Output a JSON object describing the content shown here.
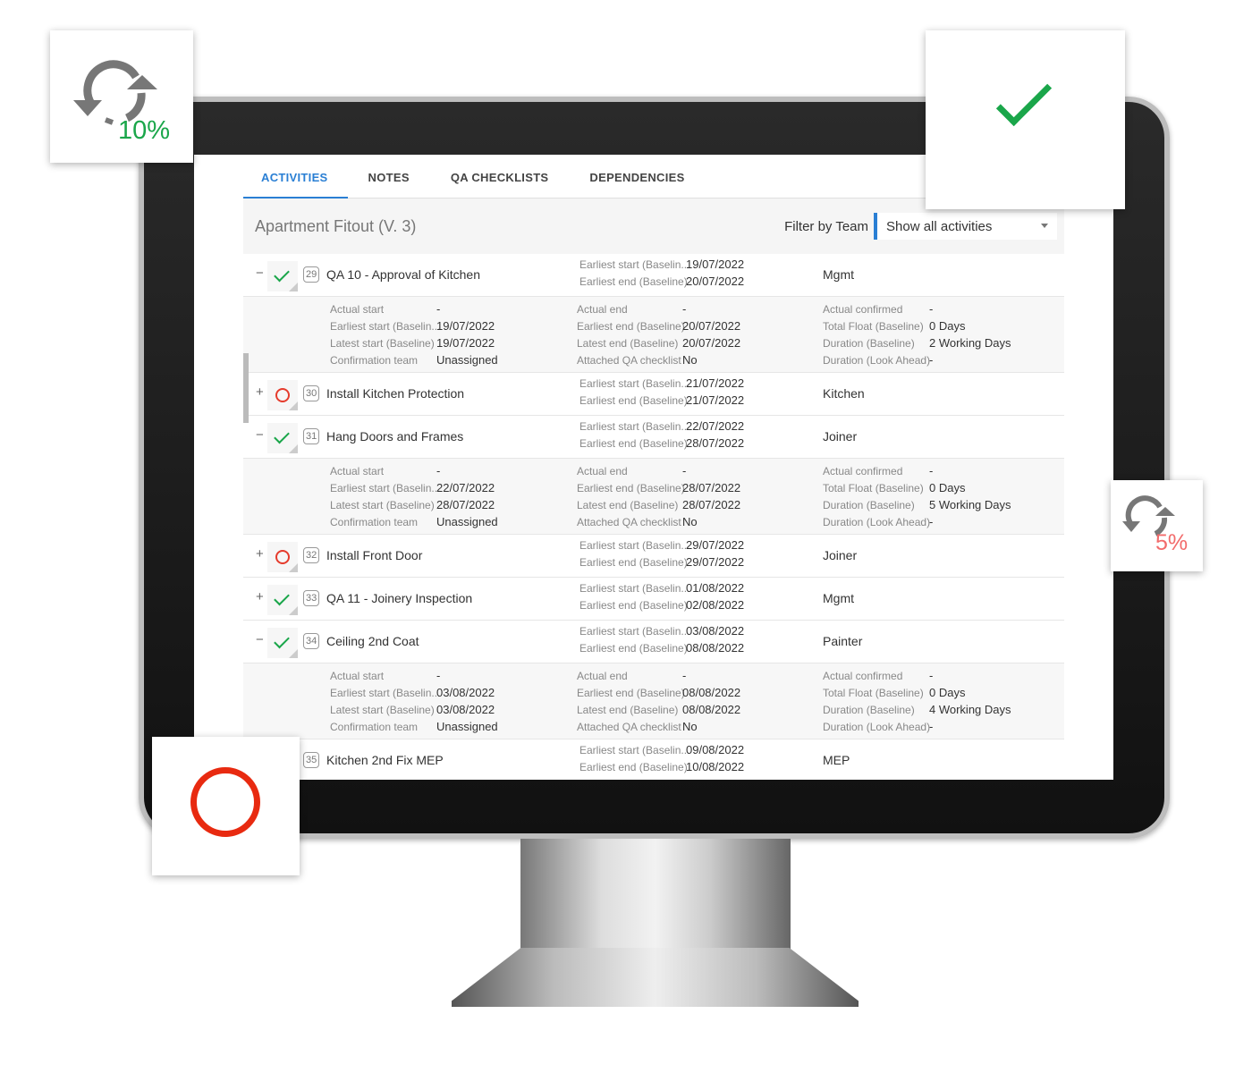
{
  "tabs": [
    {
      "label": "ACTIVITIES",
      "active": true
    },
    {
      "label": "NOTES"
    },
    {
      "label": "QA CHECKLISTS"
    },
    {
      "label": "DEPENDENCIES"
    }
  ],
  "header": {
    "title": "Apartment Fitout (V. 3)",
    "filter_label": "Filter by Team",
    "filter_value": "Show all activities"
  },
  "labels": {
    "es": "Earliest start (Baselin...",
    "ee": "Earliest end (Baseline)",
    "as": "Actual start",
    "ls": "Latest start (Baseline)",
    "ct": "Confirmation team",
    "ae": "Actual end",
    "le": "Latest end (Baseline)",
    "aq": "Attached QA checklist",
    "ac": "Actual confirmed",
    "tf": "Total Float (Baseline)",
    "db": "Duration (Baseline)",
    "dl": "Duration (Look Ahead)"
  },
  "activities": [
    {
      "id": "29",
      "name": "QA 10 - Approval of Kitchen",
      "status": "complete",
      "expanded": true,
      "es": "19/07/2022",
      "ee": "20/07/2022",
      "team": "Mgmt",
      "detail": {
        "as": "-",
        "es": "19/07/2022",
        "ls": "19/07/2022",
        "ct": "Unassigned",
        "ae": "-",
        "ee": "20/07/2022",
        "le": "20/07/2022",
        "aq": "No",
        "ac": "-",
        "tf": "0 Days",
        "db": "2 Working Days",
        "dl": "-"
      }
    },
    {
      "id": "30",
      "name": "Install Kitchen Protection",
      "status": "not-started",
      "expanded": false,
      "es": "21/07/2022",
      "ee": "21/07/2022",
      "team": "Kitchen"
    },
    {
      "id": "31",
      "name": "Hang Doors and Frames",
      "status": "complete",
      "expanded": true,
      "es": "22/07/2022",
      "ee": "28/07/2022",
      "team": "Joiner",
      "detail": {
        "as": "-",
        "es": "22/07/2022",
        "ls": "28/07/2022",
        "ct": "Unassigned",
        "ae": "-",
        "ee": "28/07/2022",
        "le": "28/07/2022",
        "aq": "No",
        "ac": "-",
        "tf": "0 Days",
        "db": "5 Working Days",
        "dl": "-"
      }
    },
    {
      "id": "32",
      "name": "Install Front Door",
      "status": "not-started",
      "expanded": false,
      "es": "29/07/2022",
      "ee": "29/07/2022",
      "team": "Joiner"
    },
    {
      "id": "33",
      "name": "QA 11 - Joinery Inspection",
      "status": "complete",
      "expanded": false,
      "es": "01/08/2022",
      "ee": "02/08/2022",
      "team": "Mgmt"
    },
    {
      "id": "34",
      "name": "Ceiling 2nd Coat",
      "status": "complete",
      "expanded": true,
      "es": "03/08/2022",
      "ee": "08/08/2022",
      "team": "Painter",
      "detail": {
        "as": "-",
        "es": "03/08/2022",
        "ls": "03/08/2022",
        "ct": "Unassigned",
        "ae": "-",
        "ee": "08/08/2022",
        "le": "08/08/2022",
        "aq": "No",
        "ac": "-",
        "tf": "0 Days",
        "db": "4 Working Days",
        "dl": "-"
      }
    },
    {
      "id": "35",
      "name": "Kitchen 2nd Fix MEP",
      "status": "not-started",
      "expanded": false,
      "es": "09/08/2022",
      "ee": "10/08/2022",
      "team": "MEP"
    }
  ],
  "cards": {
    "progress_large": "10%",
    "progress_small": "5%"
  },
  "colors": {
    "accent": "#2a7fd4",
    "complete": "#1aa64a",
    "not_started": "#e53b2c",
    "progress_up": "#1aa64a",
    "progress_down": "#f26b6b"
  }
}
